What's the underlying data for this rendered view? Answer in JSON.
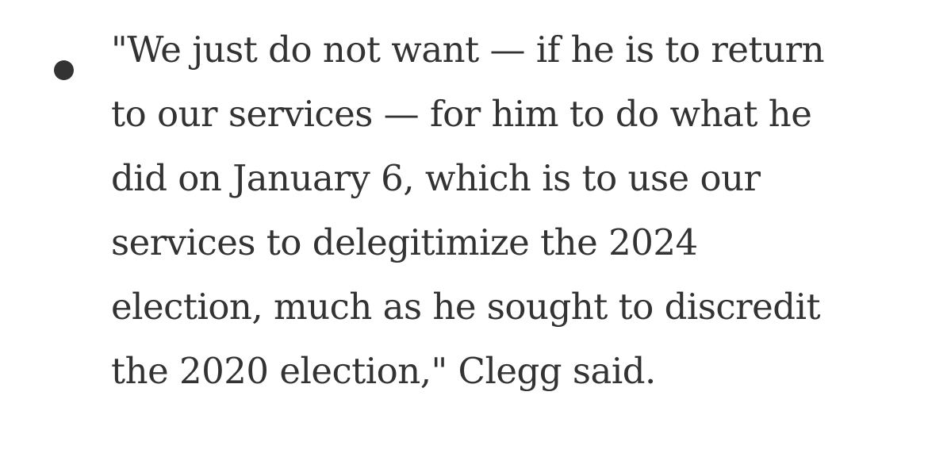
{
  "colors": {
    "text": "#333333",
    "background": "#ffffff"
  },
  "bullet_icon": "bullet-dot-icon",
  "quote": {
    "lines": [
      "\"We just do not want — if he is to return",
      "to our services — for him to do what he",
      "did on January 6, which is to use our",
      "services to delegitimize the 2024",
      "election, much as he sought to discredit",
      "the 2020 election,\" Clegg said."
    ]
  }
}
